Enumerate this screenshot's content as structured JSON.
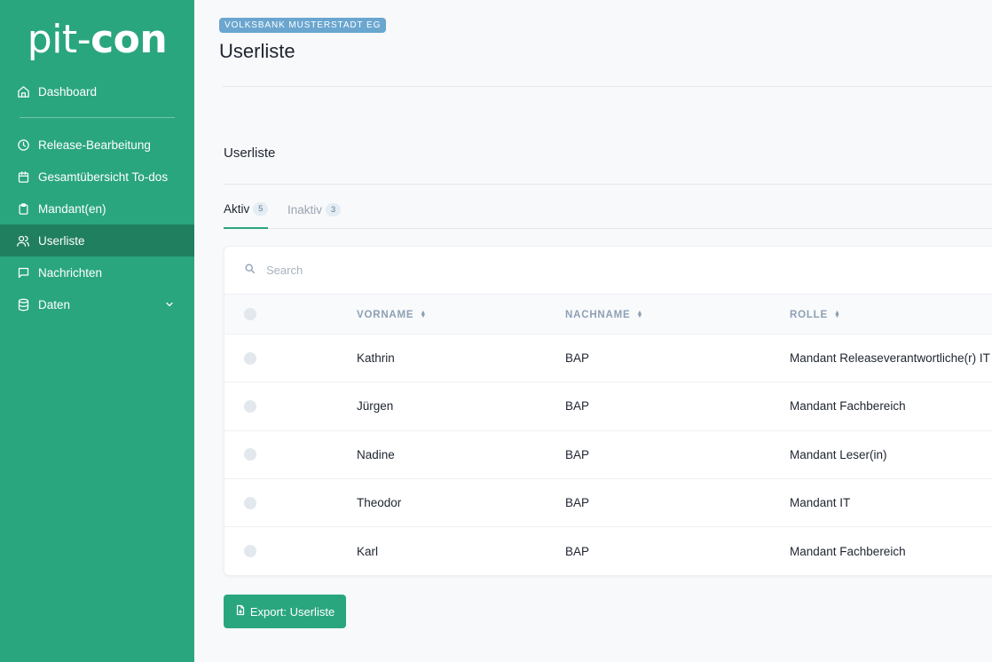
{
  "brand": {
    "logo_part1": "pit-",
    "logo_part2": "con"
  },
  "sidebar": {
    "items": [
      {
        "label": "Dashboard",
        "icon": "home-icon"
      },
      {
        "label": "Release-Bearbeitung",
        "icon": "clock-icon"
      },
      {
        "label": "Gesamtübersicht To-dos",
        "icon": "calendar-icon"
      },
      {
        "label": "Mandant(en)",
        "icon": "clipboard-icon"
      },
      {
        "label": "Userliste",
        "icon": "users-icon",
        "active": true
      },
      {
        "label": "Nachrichten",
        "icon": "message-icon"
      },
      {
        "label": "Daten",
        "icon": "database-icon",
        "has_submenu": true
      }
    ]
  },
  "header": {
    "org_badge": "VOLKSBANK MUSTERSTADT EG",
    "title": "Userliste"
  },
  "section": {
    "title": "Userliste"
  },
  "tabs": [
    {
      "label": "Aktiv",
      "count": "5",
      "active": true
    },
    {
      "label": "Inaktiv",
      "count": "3",
      "active": false
    }
  ],
  "search": {
    "placeholder": "Search"
  },
  "table": {
    "columns": [
      "VORNAME",
      "NACHNAME",
      "ROLLE"
    ],
    "rows": [
      {
        "vorname": "Kathrin",
        "nachname": "BAP",
        "rolle": "Mandant Releaseverantwortliche(r) IT"
      },
      {
        "vorname": "Jürgen",
        "nachname": "BAP",
        "rolle": "Mandant Fachbereich"
      },
      {
        "vorname": "Nadine",
        "nachname": "BAP",
        "rolle": "Mandant Leser(in)"
      },
      {
        "vorname": "Theodor",
        "nachname": "BAP",
        "rolle": "Mandant IT"
      },
      {
        "vorname": "Karl",
        "nachname": "BAP",
        "rolle": "Mandant Fachbereich"
      }
    ]
  },
  "actions": {
    "export_label": "Export: Userliste"
  },
  "colors": {
    "accent": "#2aa67e",
    "sidebar_active": "#1f7f5f",
    "badge": "#6aa6cf"
  }
}
